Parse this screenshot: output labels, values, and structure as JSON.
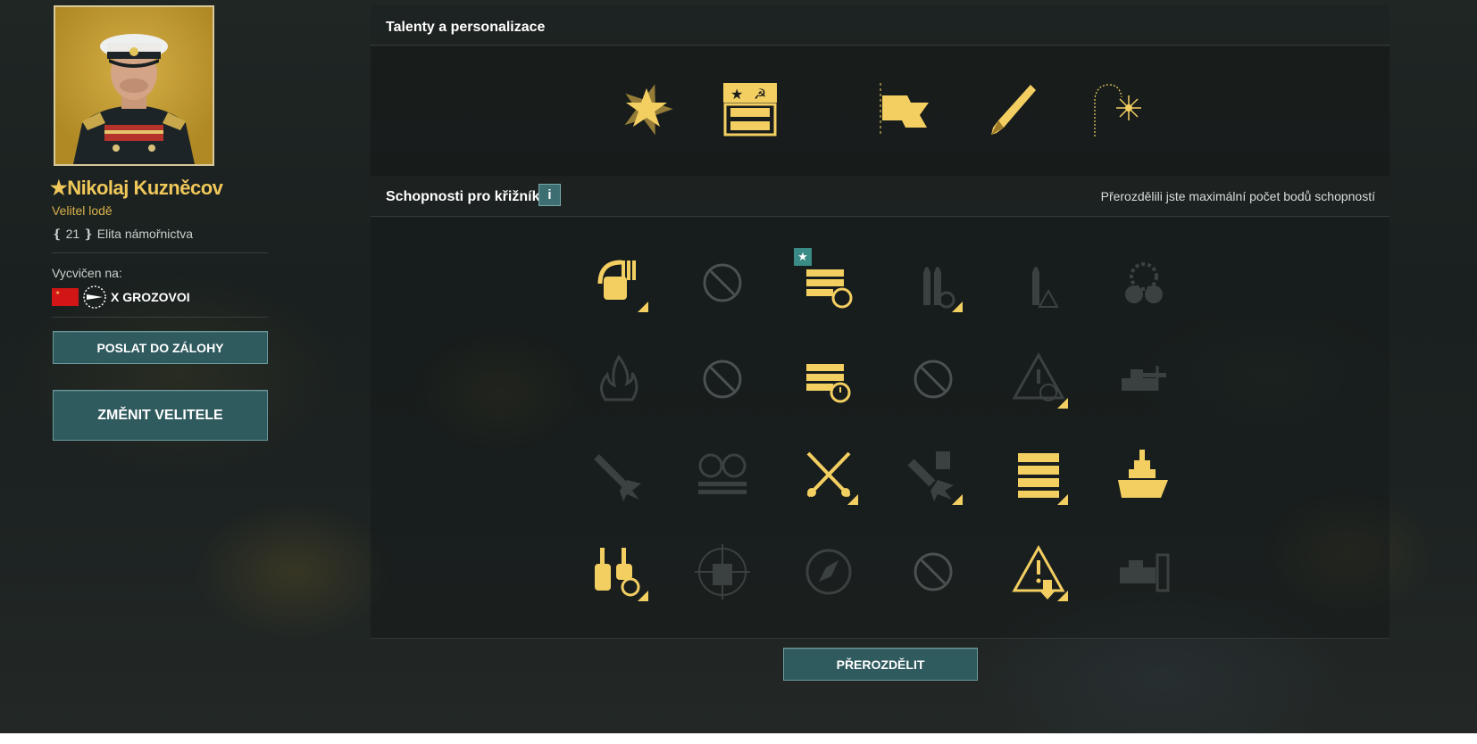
{
  "commander": {
    "name": "★Nikolaj Kuzněcov",
    "role": "Velitel lodě",
    "level_text": "❴ 21 ❵ Elita námořnictva",
    "trained_label": "Vycvičen na:",
    "ship": "X GROZOVOI"
  },
  "buttons": {
    "reserve": "POSLAT DO ZÁLOHY",
    "change": "ZMĚNIT VELITELE",
    "redistribute": "PŘEROZDĚLIT"
  },
  "talents": {
    "title": "Talenty a personalizace",
    "icons": [
      "star-emblem-icon",
      "ribbon-banner-icon",
      "flag-icon",
      "pen-icon",
      "firework-icon"
    ]
  },
  "skills": {
    "title": "Schopnosti pro křižníky",
    "info_label": "i",
    "points_message": "Přerozdělili jste maximální počet bodů schopností",
    "grid": [
      [
        {
          "icon": "turret-reload-icon",
          "state": "active",
          "corner": true,
          "badge": false
        },
        {
          "icon": "disabled-icon",
          "state": "disabled",
          "corner": false,
          "badge": false
        },
        {
          "icon": "consumable-reload-icon",
          "state": "active",
          "corner": false,
          "badge": true
        },
        {
          "icon": "shells-reload-icon",
          "state": "inactive",
          "corner": true,
          "badge": false
        },
        {
          "icon": "shell-warning-icon",
          "state": "inactive",
          "corner": false,
          "badge": false
        },
        {
          "icon": "radiation-gear-icon",
          "state": "inactive",
          "corner": false,
          "badge": false
        }
      ],
      [
        {
          "icon": "fire-icon",
          "state": "inactive",
          "corner": false,
          "badge": false
        },
        {
          "icon": "disabled-icon",
          "state": "disabled",
          "corner": false,
          "badge": false
        },
        {
          "icon": "consumable-timer-icon",
          "state": "active",
          "corner": false,
          "badge": false
        },
        {
          "icon": "disabled-icon",
          "state": "disabled",
          "corner": false,
          "badge": false
        },
        {
          "icon": "alert-scope-icon",
          "state": "inactive",
          "corner": true,
          "badge": false
        },
        {
          "icon": "ship-gun-icon",
          "state": "inactive",
          "corner": false,
          "badge": false
        }
      ],
      [
        {
          "icon": "torpedo-explosion-icon",
          "state": "inactive",
          "corner": false,
          "badge": false
        },
        {
          "icon": "ammo-racks-icon",
          "state": "inactive",
          "corner": false,
          "badge": false
        },
        {
          "icon": "crossed-rockets-icon",
          "state": "active",
          "corner": true,
          "badge": false
        },
        {
          "icon": "hammer-explosion-icon",
          "state": "inactive",
          "corner": true,
          "badge": false
        },
        {
          "icon": "consumable-stack-icon",
          "state": "active",
          "corner": true,
          "badge": false
        },
        {
          "icon": "battleship-icon",
          "state": "active",
          "corner": false,
          "badge": false
        }
      ],
      [
        {
          "icon": "turret-cycle-icon",
          "state": "active",
          "corner": true,
          "badge": false
        },
        {
          "icon": "ship-crosshair-icon",
          "state": "inactive",
          "corner": false,
          "badge": false
        },
        {
          "icon": "compass-icon",
          "state": "inactive",
          "corner": false,
          "badge": false
        },
        {
          "icon": "disabled-icon",
          "state": "disabled",
          "corner": false,
          "badge": false
        },
        {
          "icon": "alert-down-icon",
          "state": "active",
          "corner": true,
          "badge": false
        },
        {
          "icon": "ship-shield-icon",
          "state": "inactive",
          "corner": false,
          "badge": false
        }
      ]
    ]
  },
  "colors": {
    "gold": "#f3cf62",
    "inactive": "#3b4140",
    "button": "#2f5a5e"
  }
}
